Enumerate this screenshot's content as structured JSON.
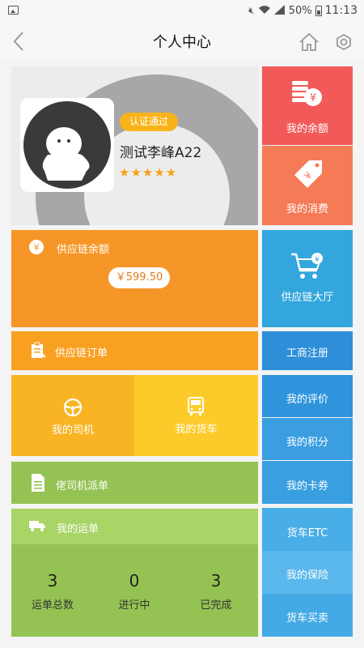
{
  "status_bar": {
    "battery": "50%",
    "time": "11:13"
  },
  "nav": {
    "title": "个人中心"
  },
  "profile": {
    "badge": "认证通过",
    "name": "测试李峰A22",
    "stars": "★★★★★"
  },
  "tiles": {
    "balance": "我的余额",
    "consume": "我的消费",
    "supply_balance": {
      "label": "供应链余额",
      "amount": "￥599.50"
    },
    "supply_hall": "供应链大厅",
    "supply_order": "供应链订单",
    "business_reg": "工商注册",
    "my_driver": "我的司机",
    "my_truck": "我的货车",
    "my_rating": "我的评价",
    "my_points": "我的积分",
    "dispatch": "佬司机派单",
    "my_coupons": "我的卡券",
    "waybill": {
      "title": "我的运单",
      "stats": [
        {
          "value": "3",
          "label": "运单总数"
        },
        {
          "value": "0",
          "label": "进行中"
        },
        {
          "value": "3",
          "label": "已完成"
        }
      ]
    },
    "truck_etc": "货车ETC",
    "insurance": "我的保险",
    "truck_trade": "货车买卖"
  },
  "colors": {
    "red": "#f25a5a",
    "coral": "#f57a56",
    "orange": "#f79628",
    "orange2": "#f9a021",
    "yellow_left": "#f9b424",
    "yellow_right": "#fccb2a",
    "green": "#94c353",
    "green_light": "#a9d466",
    "blue1": "#33a6dd",
    "blue2": "#2f94dc",
    "blue3": "#2e8cd6",
    "blue4": "#3a9fe1",
    "blue5": "#49aee7",
    "blue6": "#5bb8ec"
  }
}
